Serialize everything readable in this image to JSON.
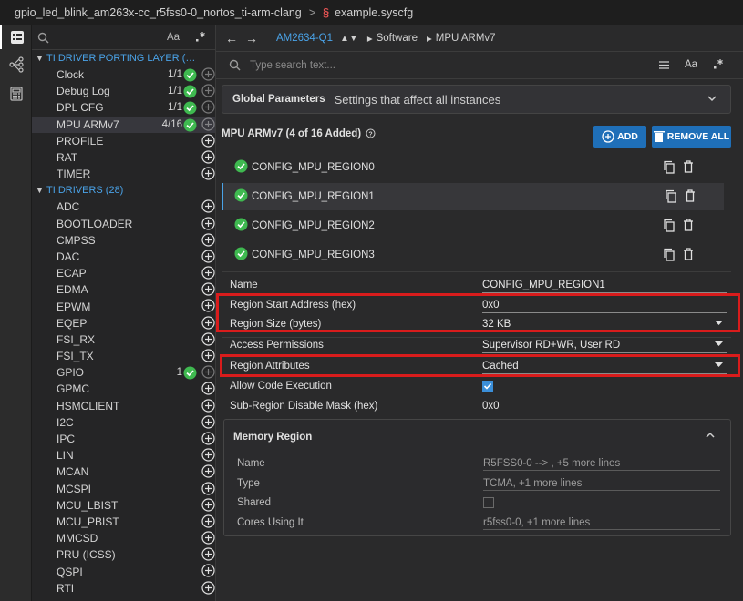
{
  "breadcrumb": {
    "project": "gpio_led_blink_am263x-cc_r5fss0-0_nortos_ti-arm-clang",
    "separator": ">",
    "file": "example.syscfg"
  },
  "activity": {
    "icons": [
      "configuration-icon",
      "topology-icon",
      "calculator-icon"
    ]
  },
  "tree": {
    "filter_case_label": "Aa",
    "groups": [
      {
        "label": "TI DRIVER PORTING LAYER (…",
        "items": [
          {
            "label": "Clock",
            "count": "1/1",
            "ok": true
          },
          {
            "label": "Debug Log",
            "count": "1/1",
            "ok": true
          },
          {
            "label": "DPL CFG",
            "count": "1/1",
            "ok": true
          },
          {
            "label": "MPU ARMv7",
            "count": "4/16",
            "ok": true,
            "selected": true
          },
          {
            "label": "PROFILE",
            "count": "",
            "ok": false
          },
          {
            "label": "RAT",
            "count": "",
            "ok": false
          },
          {
            "label": "TIMER",
            "count": "",
            "ok": false
          }
        ]
      },
      {
        "label": "TI DRIVERS (28)",
        "items": [
          {
            "label": "ADC",
            "count": "",
            "ok": false
          },
          {
            "label": "BOOTLOADER",
            "count": "",
            "ok": false
          },
          {
            "label": "CMPSS",
            "count": "",
            "ok": false
          },
          {
            "label": "DAC",
            "count": "",
            "ok": false
          },
          {
            "label": "ECAP",
            "count": "",
            "ok": false
          },
          {
            "label": "EDMA",
            "count": "",
            "ok": false
          },
          {
            "label": "EPWM",
            "count": "",
            "ok": false
          },
          {
            "label": "EQEP",
            "count": "",
            "ok": false
          },
          {
            "label": "FSI_RX",
            "count": "",
            "ok": false
          },
          {
            "label": "FSI_TX",
            "count": "",
            "ok": false
          },
          {
            "label": "GPIO",
            "count": "1",
            "ok": true
          },
          {
            "label": "GPMC",
            "count": "",
            "ok": false
          },
          {
            "label": "HSMCLIENT",
            "count": "",
            "ok": false
          },
          {
            "label": "I2C",
            "count": "",
            "ok": false
          },
          {
            "label": "IPC",
            "count": "",
            "ok": false
          },
          {
            "label": "LIN",
            "count": "",
            "ok": false
          },
          {
            "label": "MCAN",
            "count": "",
            "ok": false
          },
          {
            "label": "MCSPI",
            "count": "",
            "ok": false
          },
          {
            "label": "MCU_LBIST",
            "count": "",
            "ok": false
          },
          {
            "label": "MCU_PBIST",
            "count": "",
            "ok": false
          },
          {
            "label": "MMCSD",
            "count": "",
            "ok": false
          },
          {
            "label": "PRU (ICSS)",
            "count": "",
            "ok": false
          },
          {
            "label": "QSPI",
            "count": "",
            "ok": false
          },
          {
            "label": "RTI",
            "count": "",
            "ok": false
          }
        ]
      }
    ]
  },
  "nav": {
    "device": "AM2634-Q1",
    "crumb1": "Software",
    "crumb2": "MPU ARMv7"
  },
  "search": {
    "placeholder": "Type search text...",
    "case_label": "Aa"
  },
  "global_params": {
    "title": "Global Parameters",
    "description": "Settings that affect all instances"
  },
  "module": {
    "heading": "MPU ARMv7 (4 of 16 Added)",
    "add_label": "ADD",
    "remove_all_label": "REMOVE ALL",
    "instances": [
      "CONFIG_MPU_REGION0",
      "CONFIG_MPU_REGION1",
      "CONFIG_MPU_REGION2",
      "CONFIG_MPU_REGION3"
    ],
    "selected_index": 1
  },
  "properties": {
    "name_label": "Name",
    "name_value": "CONFIG_MPU_REGION1",
    "start_label": "Region Start Address (hex)",
    "start_value": "0x0",
    "size_label": "Region Size (bytes)",
    "size_value": "32 KB",
    "access_label": "Access Permissions",
    "access_value": "Supervisor RD+WR, User RD",
    "attr_label": "Region Attributes",
    "attr_value": "Cached",
    "exec_label": "Allow Code Execution",
    "exec_checked": true,
    "subregion_label": "Sub-Region Disable Mask (hex)",
    "subregion_value": "0x0"
  },
  "memory_region": {
    "title": "Memory Region",
    "name_label": "Name",
    "name_value": "R5FSS0-0 --> , +5 more lines",
    "type_label": "Type",
    "type_value": "TCMA, +1 more lines",
    "shared_label": "Shared",
    "shared_checked": false,
    "cores_label": "Cores Using It",
    "cores_value": "r5fss0-0, +1 more lines"
  },
  "colors": {
    "accent": "#4aa3e8",
    "ok_green": "#3fb950",
    "highlight_red": "#d91c1c",
    "button_blue": "#1f6fb8"
  }
}
